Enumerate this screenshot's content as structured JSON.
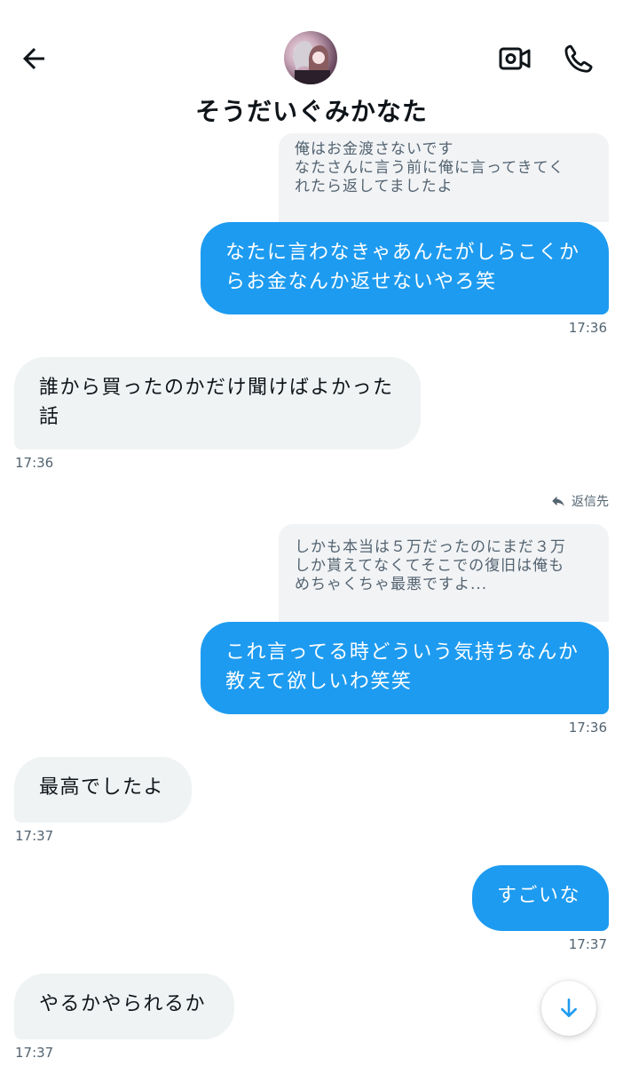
{
  "header": {
    "title": "そうだいぐみかなた",
    "back_icon": "arrow-left-icon",
    "video_icon": "video-call-icon",
    "call_icon": "phone-icon",
    "avatar": "contact-avatar"
  },
  "messages": {
    "m1": {
      "quote": [
        "俺はお金渡さないです",
        "なたさんに言う前に俺に言ってきてく",
        "れたら返してましたよ"
      ],
      "lines": [
        "なたに言わなきゃあんたがしらこくか",
        "らお金なんか返せないやろ笑"
      ],
      "time": "17:36"
    },
    "m2": {
      "lines": [
        "誰から買ったのかだけ聞けばよかった",
        "話"
      ],
      "time": "17:36"
    },
    "m3": {
      "reply_label": "返信先",
      "quote": [
        "しかも本当は５万だったのにまだ３万",
        "しか貰えてなくてそこでの復旧は俺も",
        "めちゃくちゃ最悪ですよ..."
      ],
      "lines": [
        "これ言ってる時どういう気持ちなんか",
        "教えて欲しいわ笑笑"
      ],
      "time": "17:36"
    },
    "m4": {
      "text": "最高でしたよ",
      "time": "17:37"
    },
    "m5": {
      "text": "すごいな",
      "time": "17:37"
    },
    "m6": {
      "text": "やるかやられるか",
      "time": "17:37"
    }
  },
  "colors": {
    "outgoing": "#1d9bf0",
    "incoming": "#eff3f4",
    "quote_bg": "#f2f3f5",
    "meta_text": "#536471"
  },
  "scroll_button": {
    "icon": "arrow-down-icon"
  }
}
